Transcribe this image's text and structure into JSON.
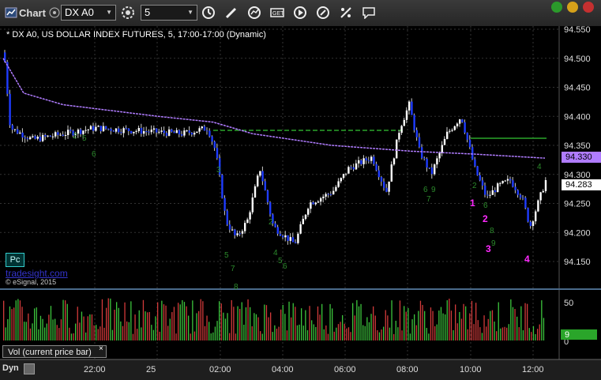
{
  "toolbar": {
    "chart_label": "Chart",
    "symbol": "DX A0",
    "interval": "5",
    "icons": [
      "chart-app-icon",
      "settings-gear-icon",
      "clock-icon",
      "draw-pencil-icon",
      "refresh-icon",
      "quote-icon",
      "play-icon",
      "edit-icon",
      "link-icon",
      "comment-icon"
    ]
  },
  "chart": {
    "title": "* DX A0, US DOLLAR INDEX FUTURES, 5, 17:00-17:00 (Dynamic)",
    "y_ticks": [
      "94.550",
      "94.500",
      "94.450",
      "94.400",
      "94.350",
      "94.300",
      "94.250",
      "94.200",
      "94.150"
    ],
    "x_ticks": [
      "22:00",
      "25",
      "02:00",
      "04:00",
      "06:00",
      "08:00",
      "10:00",
      "12:00"
    ],
    "price_tag_purple": "94.330",
    "price_tag_current": "94.283",
    "pc_label": "Pc",
    "watermark": "tradesight.com",
    "copyright": "© eSignal, 2015",
    "annotations": [
      "1",
      "2",
      "3",
      "4"
    ],
    "colors": {
      "up": "#ffffff",
      "down": "#1f3cff",
      "vwap": "#b07cff",
      "level": "#2aa52a",
      "annotation": "#ff2aff"
    }
  },
  "volume": {
    "label": "Vol (current price bar)",
    "close_symbol": "×",
    "y_ticks": [
      "50",
      "0"
    ],
    "current_value": "9"
  },
  "footer": {
    "dyn_label": "Dyn"
  }
}
